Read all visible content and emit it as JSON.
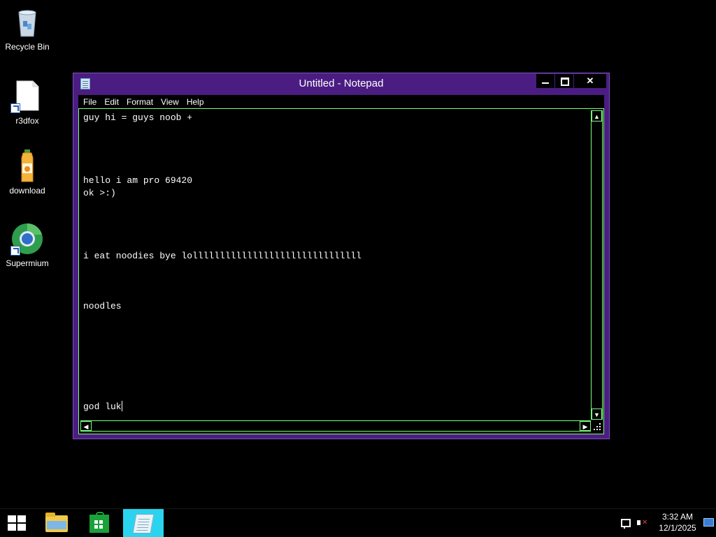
{
  "desktop": {
    "icons": [
      {
        "label": "Recycle Bin",
        "icon": "recycle-bin-icon"
      },
      {
        "label": "r3dfox",
        "icon": "blank-file-icon"
      },
      {
        "label": "download",
        "icon": "juice-bottle-icon"
      },
      {
        "label": "Supermium",
        "icon": "browser-globe-icon"
      }
    ]
  },
  "notepad": {
    "title": "Untitled - Notepad",
    "menu": [
      "File",
      "Edit",
      "Format",
      "View",
      "Help"
    ],
    "content": "guy hi = guys noob +\n\n\n\n\nhello i am pro 69420\nok >:)\n\n\n\n\ni eat noodies bye lolllllllllllllllllllllllllllllll\n\n\n\nnoodles\n\n\n\n\n\n\n\ngod luk"
  },
  "taskbar": {
    "pinned": [
      "File Explorer",
      "Store",
      "Notepad"
    ],
    "active": "Notepad",
    "clock": {
      "time": "3:32 AM",
      "date": "12/1/2025"
    }
  },
  "colors": {
    "titlebar": "#4b1d82",
    "scroll_border": "#7cff7c",
    "active_task": "#2ad4ee",
    "background": "#000000"
  }
}
